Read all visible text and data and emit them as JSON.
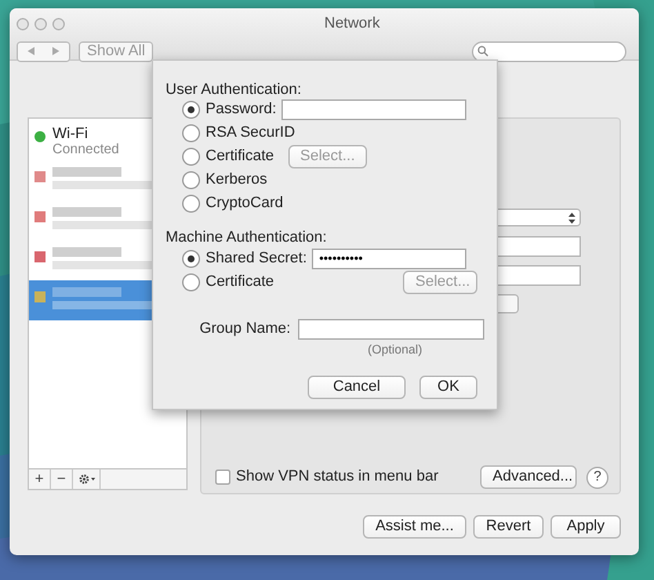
{
  "window": {
    "title": "Network"
  },
  "toolbar": {
    "show_all": "Show All"
  },
  "list_controls": {
    "add": "+",
    "remove": "−"
  },
  "sidebar": {
    "items": [
      {
        "kind": "service",
        "name": "Wi-Fi",
        "status": "Connected",
        "color": "#3cb043",
        "selected": false
      },
      {
        "kind": "redacted",
        "color": "#e08a8a",
        "selected": false
      },
      {
        "kind": "redacted",
        "color": "#e07c7c",
        "selected": false
      },
      {
        "kind": "redacted",
        "color": "#d9666e",
        "selected": false
      },
      {
        "kind": "redacted",
        "color": "#c9b25a",
        "selected": true
      }
    ]
  },
  "sheet": {
    "user_authentication": {
      "heading": "User Authentication:",
      "options": [
        {
          "kind": "field",
          "label": "Password:",
          "selected": true
        },
        {
          "kind": "plain",
          "label": "RSA SecurID",
          "selected": false
        },
        {
          "kind": "select",
          "label": "Certificate",
          "button": "Select...",
          "selected": false
        },
        {
          "kind": "plain",
          "label": "Kerberos",
          "selected": false
        },
        {
          "kind": "plain",
          "label": "CryptoCard",
          "selected": false
        }
      ]
    },
    "machine_authentication": {
      "heading": "Machine Authentication:",
      "options": [
        {
          "kind": "field",
          "label": "Shared Secret:",
          "value": "••••••••••",
          "selected": true
        },
        {
          "kind": "select_far",
          "label": "Certificate",
          "button": "Select...",
          "selected": false
        }
      ]
    },
    "group_name": {
      "label": "Group Name:",
      "hint": "(Optional)"
    },
    "buttons": [
      "Cancel",
      "OK"
    ]
  },
  "vpn_status": {
    "label": "Show VPN status in menu bar",
    "checked": false
  },
  "advanced": "Advanced...",
  "help": "?",
  "footer_buttons": [
    "Assist me...",
    "Revert",
    "Apply"
  ]
}
